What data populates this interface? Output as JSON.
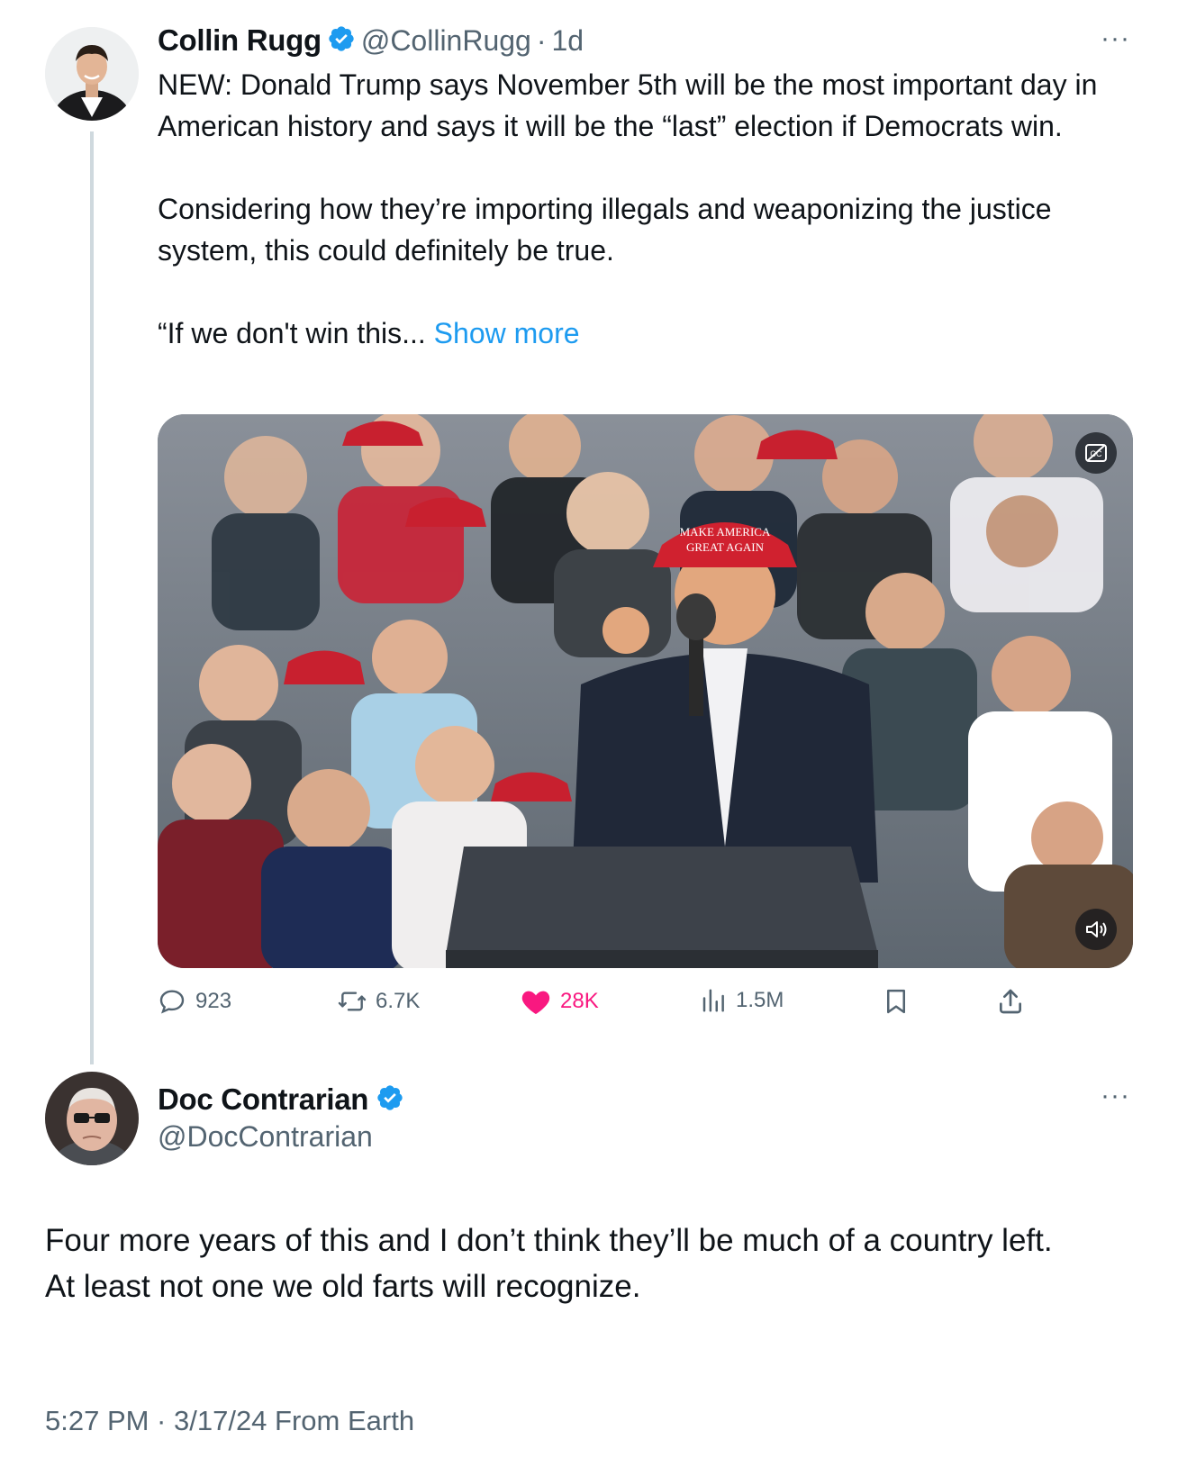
{
  "tweet": {
    "author_name": "Collin Rugg",
    "handle": "@CollinRugg",
    "separator": "·",
    "time": "1d",
    "more_label": "···",
    "paragraph_1": "NEW: Donald Trump says November 5th will be the most important day in American history and says it will be the “last” election if Democrats win.",
    "paragraph_2": "Considering how they’re importing illegals and weaponizing the justice system, this could definitely be true.",
    "paragraph_3": "“If we don't win this...",
    "show_more": "Show more",
    "media": {
      "hat_text_1": "MAKE AMERICA",
      "hat_text_2": "GREAT AGAIN",
      "captions_icon": "closed-captions-off-icon",
      "sound_icon": "volume-icon"
    },
    "stats": {
      "replies": "923",
      "reposts": "6.7K",
      "likes": "28K",
      "views": "1.5M"
    },
    "colors": {
      "accent": "#1d9bf0",
      "like": "#f91880",
      "muted": "#536471",
      "text": "#0f1419"
    }
  },
  "reply": {
    "author_name": "Doc Contrarian",
    "handle": "@DocContrarian",
    "more_label": "···",
    "line_1": "Four more years of this and I don’t think they’ll be much of a country left.",
    "line_2": "At least not one we old farts will recognize.",
    "timestamp": "5:27 PM · 3/17/24 From Earth"
  }
}
